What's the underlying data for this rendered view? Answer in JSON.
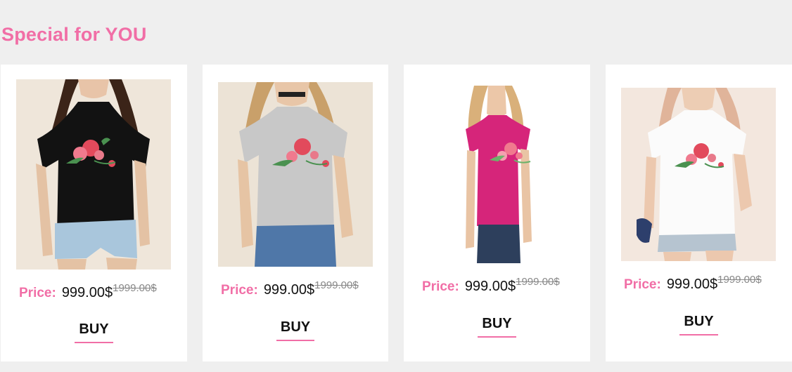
{
  "section": {
    "title": "Special for YOU"
  },
  "colors": {
    "accent": "#f16ea6",
    "background": "#efefef",
    "card": "#ffffff"
  },
  "products": [
    {
      "shirt_color": "black",
      "price_label": "Price:",
      "price": "999.00$",
      "old_price": "1999.00$",
      "buy_label": "BUY"
    },
    {
      "shirt_color": "heather gray",
      "price_label": "Price:",
      "price": "999.00$",
      "old_price": "1999.00$",
      "buy_label": "BUY"
    },
    {
      "shirt_color": "magenta",
      "price_label": "Price:",
      "price": "999.00$",
      "old_price": "1999.00$",
      "buy_label": "BUY"
    },
    {
      "shirt_color": "white",
      "price_label": "Price:",
      "price": "999.00$",
      "old_price": "1999.00$",
      "buy_label": "BUY"
    }
  ]
}
